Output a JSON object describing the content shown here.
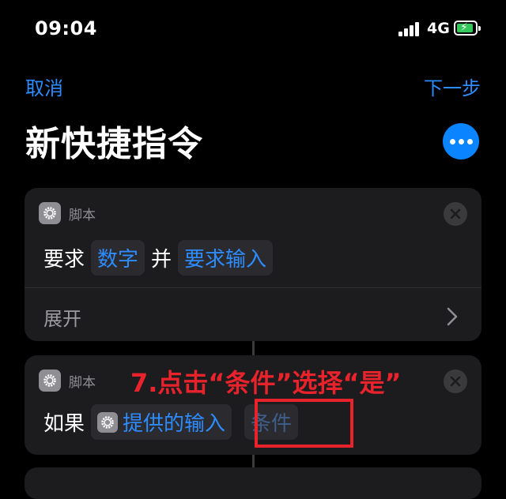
{
  "status_bar": {
    "time": "09:04",
    "network": "4G"
  },
  "nav": {
    "cancel_label": "取消",
    "next_label": "下一步"
  },
  "page": {
    "title": "新快捷指令"
  },
  "actions": [
    {
      "type_label": "脚本",
      "text_before": "要求",
      "token_1": "数字",
      "text_mid": "并",
      "token_2": "要求输入",
      "expand_label": "展开"
    },
    {
      "type_label": "脚本",
      "text_before": "如果",
      "token_1": "提供的输入",
      "token_2": "条件"
    }
  ],
  "annotation": {
    "text": "7.点击“条件”选择“是”"
  },
  "icons": {
    "gear": "gear-icon",
    "close": "close-icon",
    "chevron": "chevron-right-icon",
    "more": "more-icon"
  },
  "colors": {
    "accent": "#0a84ff",
    "link": "#2d8cff",
    "highlight": "#e8232c",
    "battery": "#34c759"
  }
}
